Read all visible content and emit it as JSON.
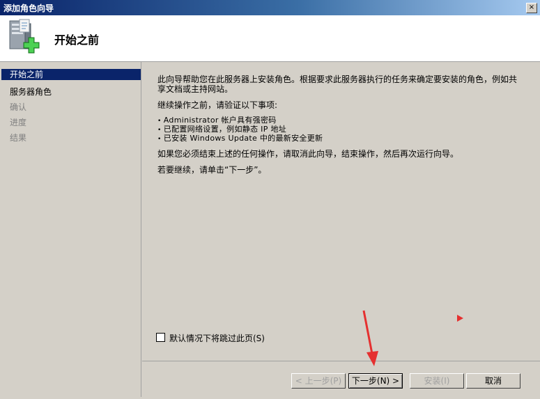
{
  "window": {
    "title": "添加角色向导",
    "close_label": "×"
  },
  "header": {
    "title": "开始之前",
    "icon": "server-add-icon"
  },
  "nav": {
    "items": [
      {
        "label": "开始之前",
        "state": "active"
      },
      {
        "label": "服务器角色",
        "state": "enabled"
      },
      {
        "label": "确认",
        "state": "disabled"
      },
      {
        "label": "进度",
        "state": "disabled"
      },
      {
        "label": "结果",
        "state": "disabled"
      }
    ]
  },
  "content": {
    "intro": "此向导帮助您在此服务器上安装角色。根据要求此服务器执行的任务来确定要安装的角色，例如共享文档或主持网站。",
    "lead": "继续操作之前，请验证以下事项:",
    "bullets": [
      "Administrator 帐户具有强密码",
      "已配置网络设置，例如静态 IP 地址",
      "已安装 Windows Update 中的最新安全更新"
    ],
    "cancel_note": "如果您必须结束上述的任何操作，请取消此向导，结束操作，然后再次运行向导。",
    "next_note": "若要继续，请单击“下一步”。",
    "skip_checkbox": {
      "label": "默认情况下将跳过此页(S)",
      "checked": false
    }
  },
  "footer": {
    "prev_label": "< 上一步(P)",
    "next_label": "下一步(N) >",
    "install_label": "安装(I)",
    "cancel_label": "取消"
  },
  "colors": {
    "accent": "#0a246a",
    "annotation_red": "#e53030"
  }
}
